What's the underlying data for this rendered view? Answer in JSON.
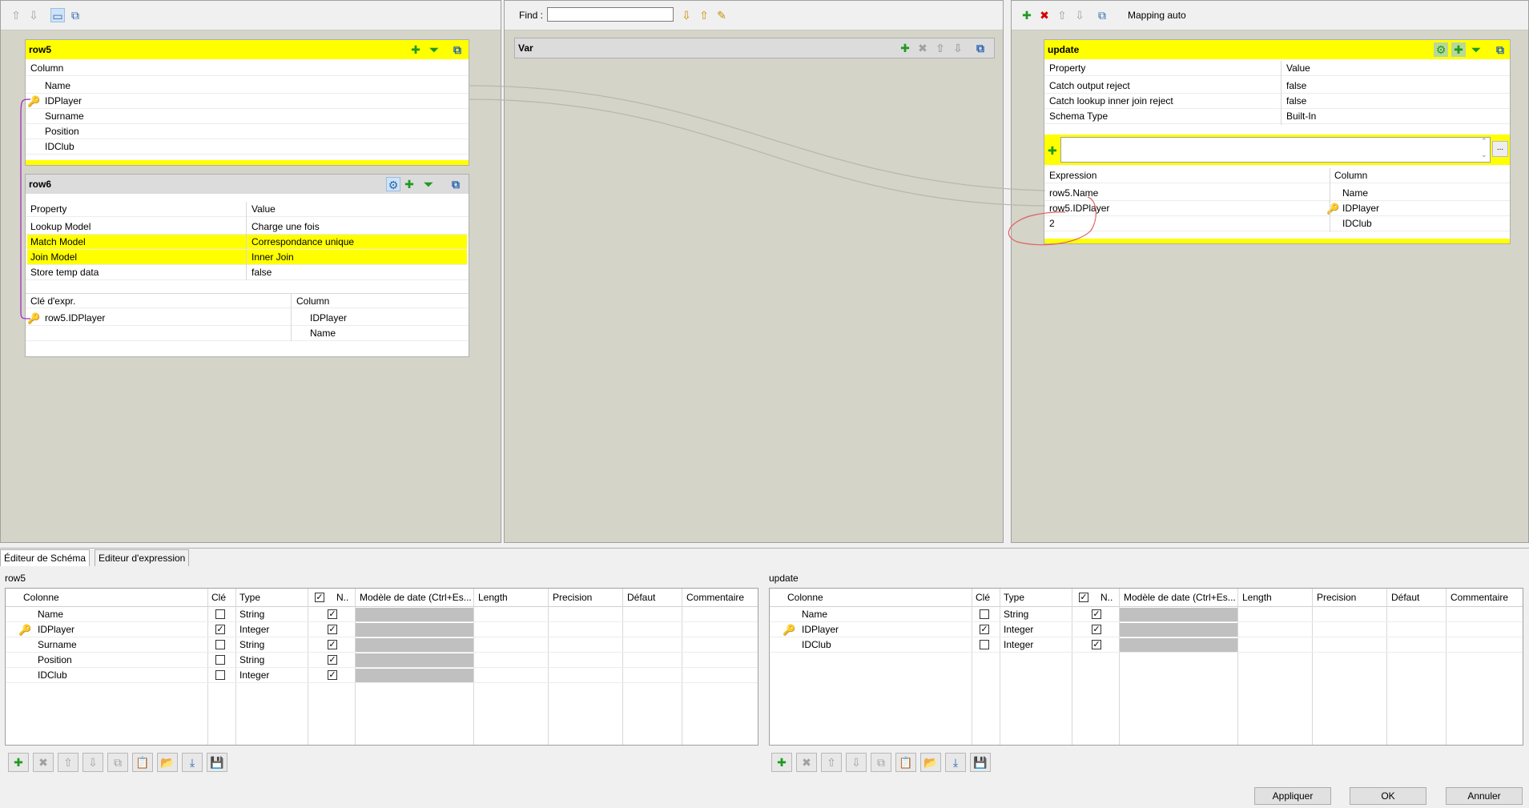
{
  "left_pane": {
    "toolbar": [
      "up-arrow-icon",
      "down-arrow-icon",
      "layout-icon",
      "minimize-icon"
    ],
    "row5": {
      "title": "row5",
      "column_header": "Column",
      "columns": [
        "Name",
        "IDPlayer",
        "Surname",
        "Position",
        "IDClub"
      ]
    },
    "row6": {
      "title": "row6",
      "prop_header": "Property",
      "value_header": "Value",
      "properties": [
        {
          "name": "Lookup Model",
          "value": "Charge une fois"
        },
        {
          "name": "Match Model",
          "value": "Correspondance unique"
        },
        {
          "name": "Join Model",
          "value": "Inner Join"
        },
        {
          "name": "Store temp data",
          "value": "false"
        }
      ],
      "key_header": "Clé d'expr.",
      "col_header": "Column",
      "keys": [
        {
          "expr": "row5.IDPlayer",
          "column": "IDPlayer"
        },
        {
          "expr": "",
          "column": "Name"
        }
      ]
    }
  },
  "middle_pane": {
    "find_label": "Find :",
    "find_value": "",
    "var_title": "Var"
  },
  "right_pane": {
    "mapping_auto": "Mapping auto",
    "update": {
      "title": "update",
      "prop_header": "Property",
      "value_header": "Value",
      "properties": [
        {
          "name": "Catch output reject",
          "value": "false"
        },
        {
          "name": "Catch lookup inner join reject",
          "value": "false"
        },
        {
          "name": "Schema Type",
          "value": "Built-In"
        }
      ],
      "expr_header": "Expression",
      "col_header": "Column",
      "rows": [
        {
          "expr": "row5.Name",
          "column": "Name"
        },
        {
          "expr": "row5.IDPlayer",
          "column": "IDPlayer"
        },
        {
          "expr": "2",
          "column": "IDClub"
        }
      ],
      "expression_filter": ""
    }
  },
  "bottom": {
    "tabs": [
      "Éditeur de  Schéma",
      "Editeur d'expression"
    ],
    "headers": [
      "Colonne",
      "Clé",
      "Type",
      "N..",
      "Modèle de date (Ctrl+Es...",
      "Length",
      "Precision",
      "Défaut",
      "Commentaire"
    ],
    "left_schema": {
      "title": "row5",
      "rows": [
        {
          "name": "Name",
          "key": false,
          "type": "String",
          "nullable": true
        },
        {
          "name": "IDPlayer",
          "key": true,
          "type": "Integer",
          "nullable": true
        },
        {
          "name": "Surname",
          "key": false,
          "type": "String",
          "nullable": true
        },
        {
          "name": "Position",
          "key": false,
          "type": "String",
          "nullable": true
        },
        {
          "name": "IDClub",
          "key": false,
          "type": "Integer",
          "nullable": true
        }
      ]
    },
    "right_schema": {
      "title": "update",
      "rows": [
        {
          "name": "Name",
          "key": false,
          "type": "String",
          "nullable": true
        },
        {
          "name": "IDPlayer",
          "key": true,
          "type": "Integer",
          "nullable": true
        },
        {
          "name": "IDClub",
          "key": false,
          "type": "Integer",
          "nullable": true
        }
      ]
    },
    "buttons": {
      "apply": "Appliquer",
      "ok": "OK",
      "cancel": "Annuler"
    }
  },
  "colors": {
    "highlight": "#ffff00",
    "pane_bg": "#d4d4c8",
    "annotation": "#e06060",
    "link": "#a020c0"
  }
}
